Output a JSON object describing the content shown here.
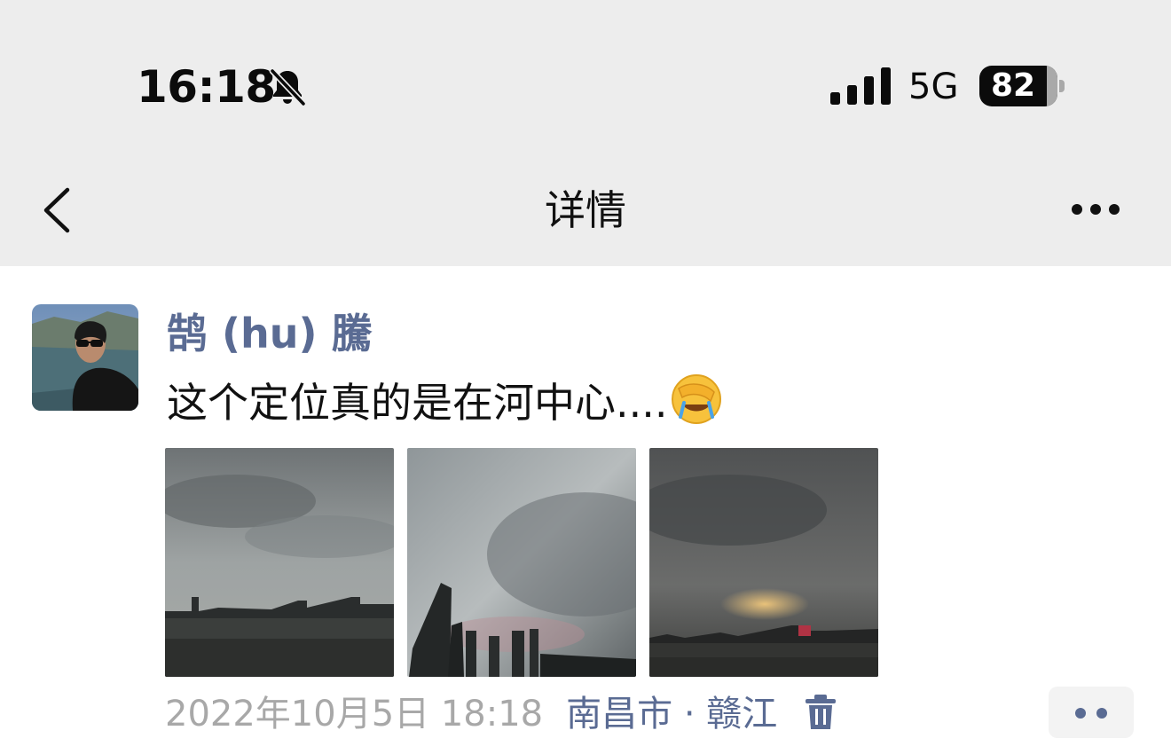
{
  "status_bar": {
    "time": "16:18",
    "network": "5G",
    "battery": "82",
    "battery_level": 0.82,
    "icons": [
      "bell-slash-icon",
      "signal-bars-icon",
      "battery-icon"
    ]
  },
  "nav": {
    "title": "详情",
    "back_icon": "chevron-left-icon",
    "more_icon": "ellipsis-icon"
  },
  "post": {
    "author": "鹄 (hu) 騰",
    "text": "这个定位真的是在河中心....",
    "emoji": "face-palm-emoji",
    "photos": [
      {
        "name": "photo-1"
      },
      {
        "name": "photo-2"
      },
      {
        "name": "photo-3"
      }
    ],
    "timestamp": "2022年10月5日 18:18",
    "location": "南昌市 · 赣江",
    "delete_icon": "trash-icon",
    "action_icon": "two-dots-icon"
  },
  "colors": {
    "link": "#5a6b93",
    "header_bg": "#ededed",
    "muted": "#a8a8a8"
  }
}
